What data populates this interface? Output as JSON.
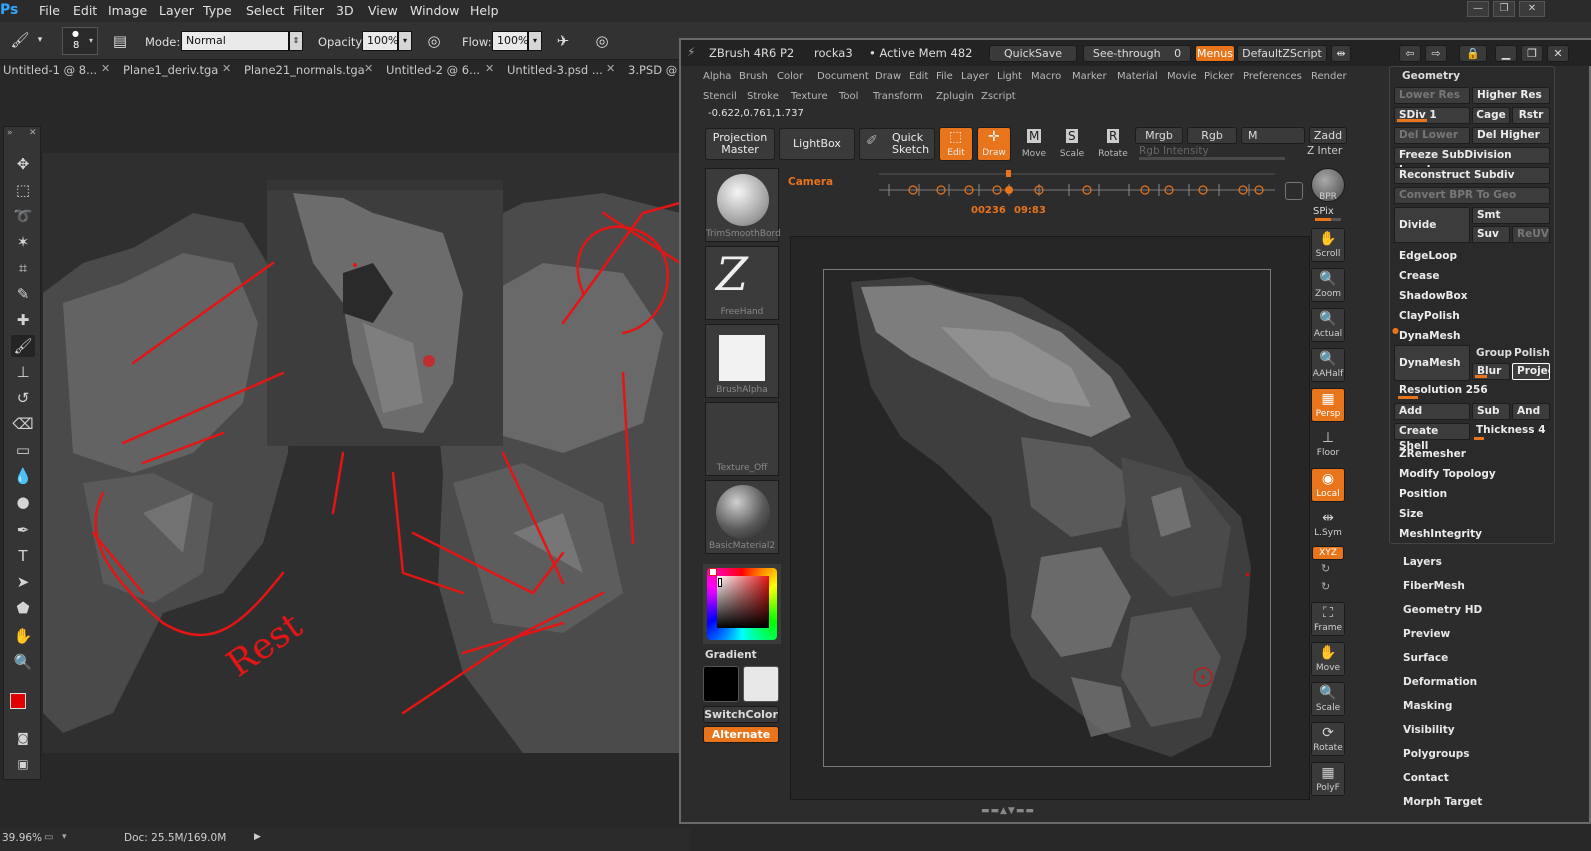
{
  "photoshop": {
    "logo": "Ps",
    "menu": [
      "File",
      "Edit",
      "Image",
      "Layer",
      "Type",
      "Select",
      "Filter",
      "3D",
      "View",
      "Window",
      "Help"
    ],
    "options": {
      "brush_size": "8",
      "mode_label": "Mode:",
      "mode_value": "Normal",
      "opacity_label": "Opacity:",
      "opacity_value": "100%",
      "flow_label": "Flow:",
      "flow_value": "100%"
    },
    "tabs": [
      "Untitled-1 @ 8...",
      "Plane1_deriv.tga",
      "Plane21_normals.tga",
      "Untitled-2 @ 6...",
      "Untitled-3.psd ...",
      "3.PSD @"
    ],
    "status": {
      "zoom": "39.96%",
      "doc": "Doc: 25.5M/169.0M"
    },
    "sketch_text": "Rest",
    "colors": {
      "foreground": "#e30000",
      "background": "#ffffff",
      "annotation": "#e31515"
    }
  },
  "zbrush": {
    "title": "ZBrush 4R6 P2",
    "doc_name": "rocka3",
    "active_mem": "• Active Mem 482",
    "quicksave": "QuickSave",
    "seethrough_label": "See-through",
    "seethrough_value": "0",
    "menus_btn": "Menus",
    "zscript": "DefaultZScript",
    "menu_row1": [
      "Alpha",
      "Brush",
      "Color",
      "Document",
      "Draw",
      "Edit",
      "File",
      "Layer",
      "Light",
      "Macro",
      "Marker",
      "Material",
      "Movie",
      "Picker",
      "Preferences",
      "Render"
    ],
    "menu_row2": [
      "Stencil",
      "Stroke",
      "Texture",
      "Tool",
      "Transform",
      "Zplugin",
      "Zscript"
    ],
    "coords": "-0.622,0.761,1.737",
    "top": {
      "projection_master": "Projection Master",
      "lightbox": "LightBox",
      "quick_sketch": "Quick Sketch",
      "edit": "Edit",
      "draw": "Draw",
      "move": "Move",
      "scale": "Scale",
      "rotate": "Rotate",
      "mrgb": "Mrgb",
      "rgb": "Rgb",
      "m": "M",
      "zadd": "Zadd",
      "rgb_intensity": "Rgb Intensity",
      "z_intensity": "Z Inter"
    },
    "camera": "Camera",
    "timeline": {
      "left": "00236",
      "right": "09:83"
    },
    "left_shelf": {
      "brush": "TrimSmoothBord",
      "stroke": "FreeHand",
      "alpha": "BrushAlpha",
      "texture": "Texture_Off",
      "material": "BasicMaterial2",
      "gradient": "Gradient",
      "switchcolor": "SwitchColor",
      "alternate": "Alternate"
    },
    "right_shelf": [
      "BPR",
      "SPix",
      "Scroll",
      "Zoom",
      "Actual",
      "AAHalf",
      "Persp",
      "Floor",
      "Local",
      "L.Sym",
      "XYZ",
      "Frame",
      "Move",
      "Scale",
      "Rotate",
      "PolyF"
    ],
    "geometry": {
      "title": "Geometry",
      "lower_res": "Lower Res",
      "higher_res": "Higher Res",
      "sdiv": "SDiv 1",
      "cage": "Cage",
      "rstr": "Rstr",
      "del_lower": "Del Lower",
      "del_higher": "Del Higher",
      "freeze": "Freeze SubDivision Levels",
      "reconstruct": "Reconstruct Subdiv",
      "convert_bpr": "Convert BPR To Geo",
      "divide": "Divide",
      "smt": "Smt",
      "suv": "Suv",
      "reuv": "ReUV",
      "edgeloop": "EdgeLoop",
      "crease": "Crease",
      "shadowbox": "ShadowBox",
      "claypolish": "ClayPolish",
      "dynamesh_header": "DynaMesh",
      "dynamesh_btn": "DynaMesh",
      "group": "Group",
      "polish": "Polish",
      "blur": "Blur",
      "project": "Projec",
      "resolution": "Resolution 256",
      "add": "Add",
      "sub": "Sub",
      "and": "And",
      "create_shell": "Create Shell",
      "thickness": "Thickness 4",
      "zremesher": "ZRemesher",
      "modify_topology": "Modify Topology",
      "position": "Position",
      "size": "Size",
      "meshintegrity": "MeshIntegrity"
    },
    "submenus": [
      "Layers",
      "FiberMesh",
      "Geometry HD",
      "Preview",
      "Surface",
      "Deformation",
      "Masking",
      "Visibility",
      "Polygroups",
      "Contact",
      "Morph Target"
    ],
    "accent": "#e8741c"
  }
}
